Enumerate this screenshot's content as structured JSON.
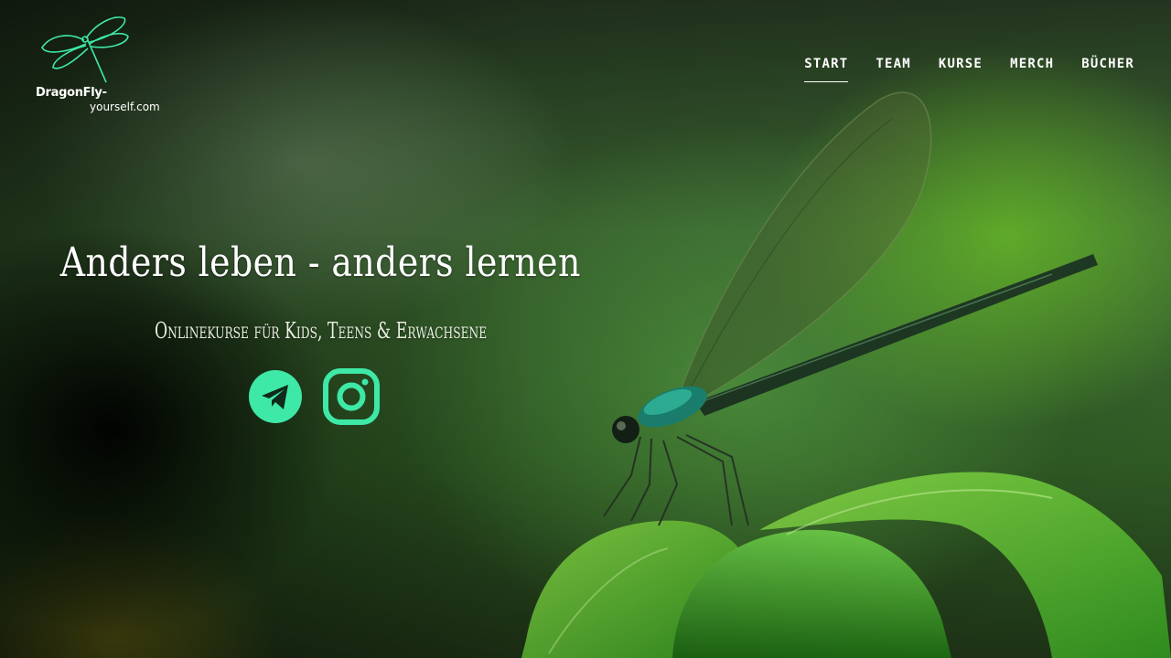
{
  "brand": {
    "logo_line1": "DragonFly-",
    "logo_line2": "yourself.com",
    "accent": "#3ee8a6"
  },
  "nav": {
    "items": [
      {
        "label": "START",
        "active": true
      },
      {
        "label": "TEAM",
        "active": false
      },
      {
        "label": "KURSE",
        "active": false
      },
      {
        "label": "MERCH",
        "active": false
      },
      {
        "label": "BÜCHER",
        "active": false
      }
    ]
  },
  "hero": {
    "headline": "Anders leben - anders lernen",
    "subline": "Onlinekurse für Kids, Teens & Erwachsene"
  },
  "social": {
    "icons": [
      "telegram-icon",
      "instagram-icon"
    ]
  }
}
